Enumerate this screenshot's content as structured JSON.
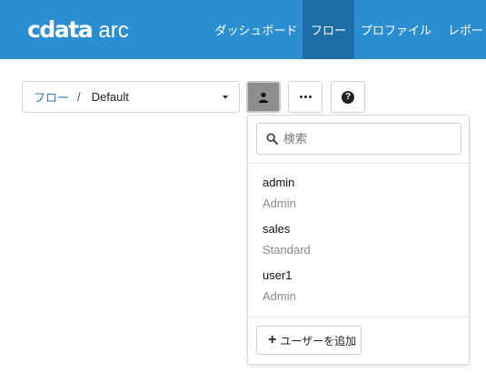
{
  "header": {
    "logo_main": "cdata",
    "logo_sub": "arc",
    "nav": [
      "ダッシュボード",
      "フロー",
      "プロファイル",
      "レポート"
    ],
    "active_nav": "フロー",
    "bg_color": "#2b8ed0",
    "active_color": "#1e6fa7"
  },
  "breadcrumb": {
    "root": "フロー",
    "separator": "/",
    "current": "Default"
  },
  "toolbar": {
    "user_icon": "user-icon",
    "more_icon": "ellipsis-icon",
    "help_icon": "help-icon",
    "help_glyph": "?"
  },
  "user_panel": {
    "search_placeholder": "検索",
    "users": [
      {
        "name": "admin",
        "role": "Admin"
      },
      {
        "name": "sales",
        "role": "Standard"
      },
      {
        "name": "user1",
        "role": "Admin"
      }
    ],
    "add_button_label": "ユーザーを追加"
  }
}
